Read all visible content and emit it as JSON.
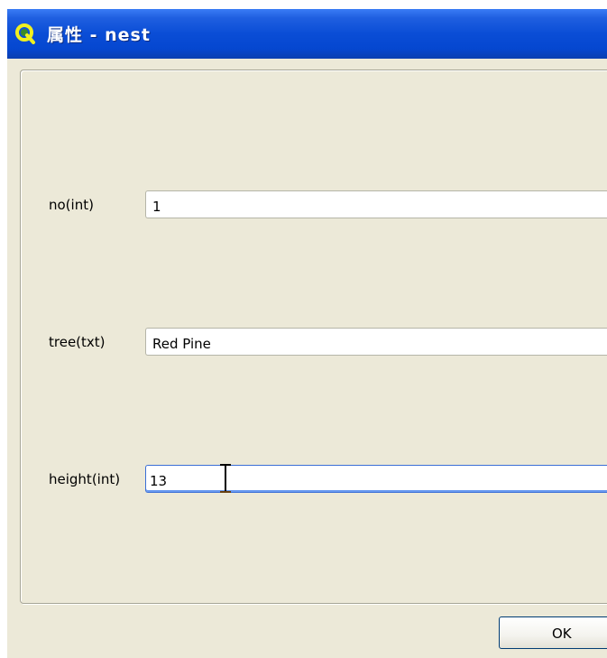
{
  "window": {
    "title": "属性 - nest",
    "icon": "qgis-icon"
  },
  "fields": [
    {
      "label": "no(int)",
      "value": "1"
    },
    {
      "label": "tree(txt)",
      "value": "Red Pine"
    },
    {
      "label": "height(int)",
      "value": "13"
    }
  ],
  "buttons": {
    "ok_label": "OK"
  },
  "colors": {
    "titlebar": "#0a4dd6",
    "dialog_background": "#ece9d8",
    "active_input_border": "#3b6fd6"
  }
}
